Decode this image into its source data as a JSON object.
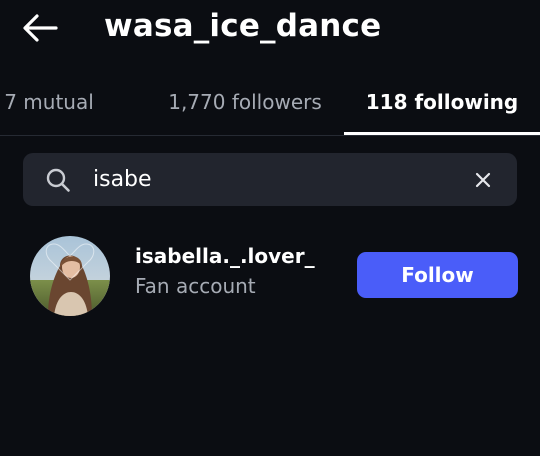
{
  "header": {
    "title": "wasa_ice_dance",
    "back_icon": "arrow-left-icon"
  },
  "tabs": [
    {
      "label": "7 mutual",
      "selected": false
    },
    {
      "label": "1,770 followers",
      "selected": false
    },
    {
      "label": "118 following",
      "selected": true
    }
  ],
  "search": {
    "value": "isabe",
    "search_icon": "search-icon",
    "clear_icon": "close-icon"
  },
  "results": [
    {
      "username": "isabella._.lover_",
      "subtitle": "Fan account",
      "action_label": "Follow"
    }
  ],
  "colors": {
    "background": "#0b0d12",
    "search_bg": "#22252e",
    "accent": "#4a5df9",
    "muted_text": "#a6abb4",
    "primary_text": "#ffffff"
  }
}
